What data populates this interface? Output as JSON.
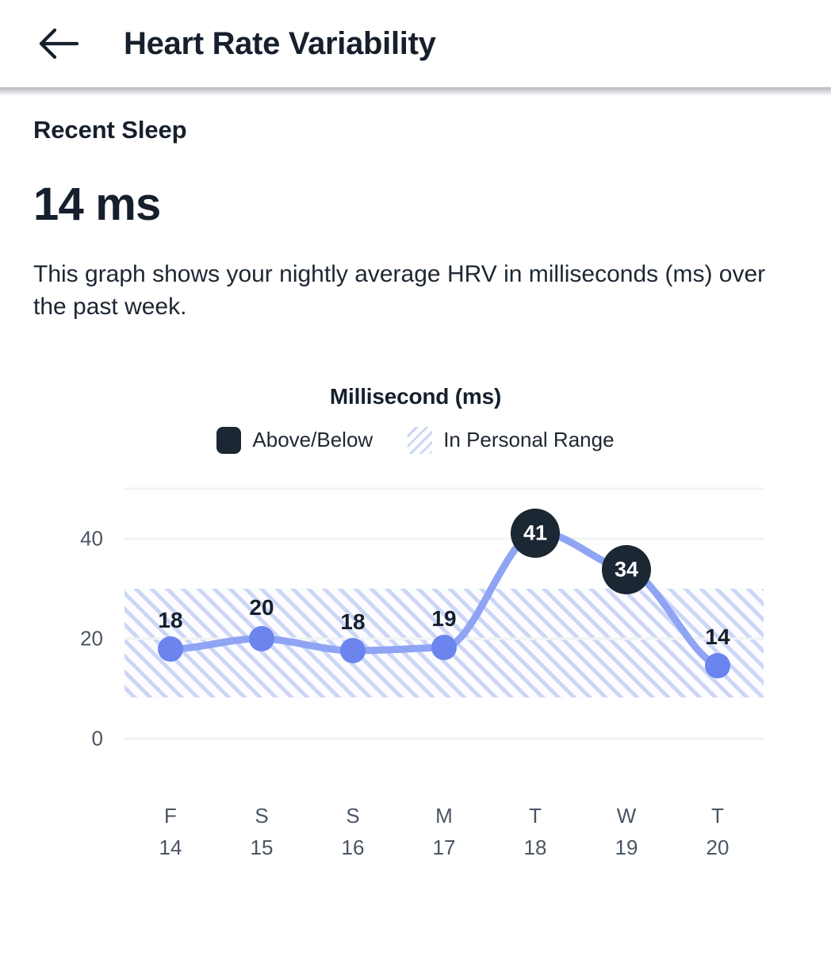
{
  "header": {
    "back_icon": "arrow-left-icon",
    "title": "Heart Rate Variability"
  },
  "main": {
    "section_label": "Recent Sleep",
    "big_value": "14 ms",
    "description": "This graph shows your nightly average HRV in milliseconds (ms) over the past week."
  },
  "chart": {
    "title": "Millisecond (ms)",
    "legend": [
      {
        "label": "Above/Below",
        "swatch": "solid",
        "color": "#1b2733"
      },
      {
        "label": "In Personal Range",
        "swatch": "hatch",
        "color": "#ccd6f7"
      }
    ]
  },
  "colors": {
    "line": "#8fa4f3",
    "dot_in_range": "#6b84ee",
    "dot_out_range": "#1b2733",
    "label_dark": "#16202c",
    "grid": "#f3f4f6",
    "band_stripe": "#ccd6f7",
    "text_muted": "#4a5563"
  },
  "chart_data": {
    "type": "line",
    "title": "Millisecond (ms)",
    "xlabel": "",
    "ylabel": "Milliseconds (ms)",
    "ylim": [
      0,
      48
    ],
    "yticks": [
      0,
      20,
      40
    ],
    "ytick_labels": [
      "0",
      "20",
      "40"
    ],
    "grid": true,
    "gridlines_at": [
      0,
      40,
      48
    ],
    "legend_position": "top-center",
    "categories": [
      "F 14",
      "S 15",
      "S 16",
      "M 17",
      "T 18",
      "W 19",
      "T 20"
    ],
    "x_tick_dow": [
      "F",
      "S",
      "S",
      "M",
      "T",
      "W",
      "T"
    ],
    "x_tick_dom": [
      "14",
      "15",
      "16",
      "17",
      "18",
      "19",
      "20"
    ],
    "values": [
      18,
      20,
      18,
      19,
      41,
      34,
      14
    ],
    "point_labels": [
      "18",
      "20",
      "18",
      "19",
      "41",
      "34",
      "14"
    ],
    "point_states": [
      "in-range",
      "in-range",
      "in-range",
      "in-range",
      "above",
      "above",
      "in-range"
    ],
    "personal_range": {
      "label": "In Personal Range",
      "min": 8,
      "max": 30
    },
    "series": [
      {
        "name": "Nightly average HRV",
        "values": [
          18,
          20,
          18,
          19,
          41,
          34,
          14
        ]
      }
    ]
  }
}
